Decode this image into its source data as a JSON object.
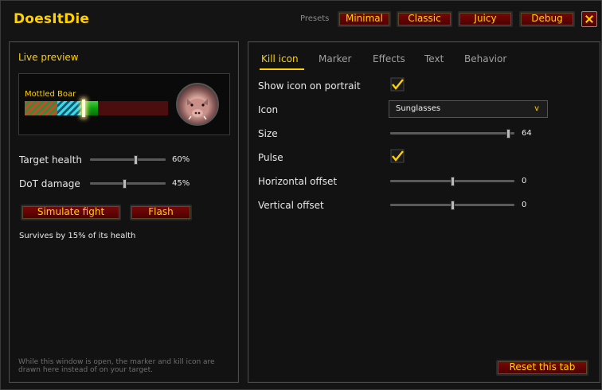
{
  "window": {
    "title": "DoesItDie",
    "presets_label": "Presets",
    "presets": [
      "Minimal",
      "Classic",
      "Juicy",
      "Debug"
    ],
    "close_icon": "close-x-icon"
  },
  "left": {
    "section_title": "Live preview",
    "unit_name": "Mottled Boar",
    "portrait_icon": "boar-portrait",
    "health_pct": 0.6,
    "dot_pct": 0.45,
    "sliders": [
      {
        "label": "Target health",
        "value": "60%",
        "fraction": 0.6
      },
      {
        "label": "DoT damage",
        "value": "45%",
        "fraction": 0.45
      }
    ],
    "simulate_label": "Simulate fight",
    "flash_label": "Flash",
    "result_text": "Survives by 15% of its health",
    "footnote": "While this window is open, the marker and kill icon are drawn here instead of on your target."
  },
  "right": {
    "tabs": [
      "Kill icon",
      "Marker",
      "Effects",
      "Text",
      "Behavior"
    ],
    "active_tab": "Kill icon",
    "show_icon_label": "Show icon on portrait",
    "show_icon_checked": true,
    "icon_label": "Icon",
    "icon_value": "Sunglasses",
    "icon_arrow": "v",
    "size_label": "Size",
    "size_value": "64",
    "size_fraction": 0.95,
    "pulse_label": "Pulse",
    "pulse_checked": true,
    "hoffset_label": "Horizontal offset",
    "hoffset_value": "0",
    "hoffset_fraction": 0.5,
    "voffset_label": "Vertical offset",
    "voffset_value": "0",
    "voffset_fraction": 0.5,
    "reset_label": "Reset this tab"
  },
  "colors": {
    "accent": "#ffd100",
    "button": "#6a0404",
    "health": "#20b020",
    "dot_stripes": "#40d8e8"
  }
}
